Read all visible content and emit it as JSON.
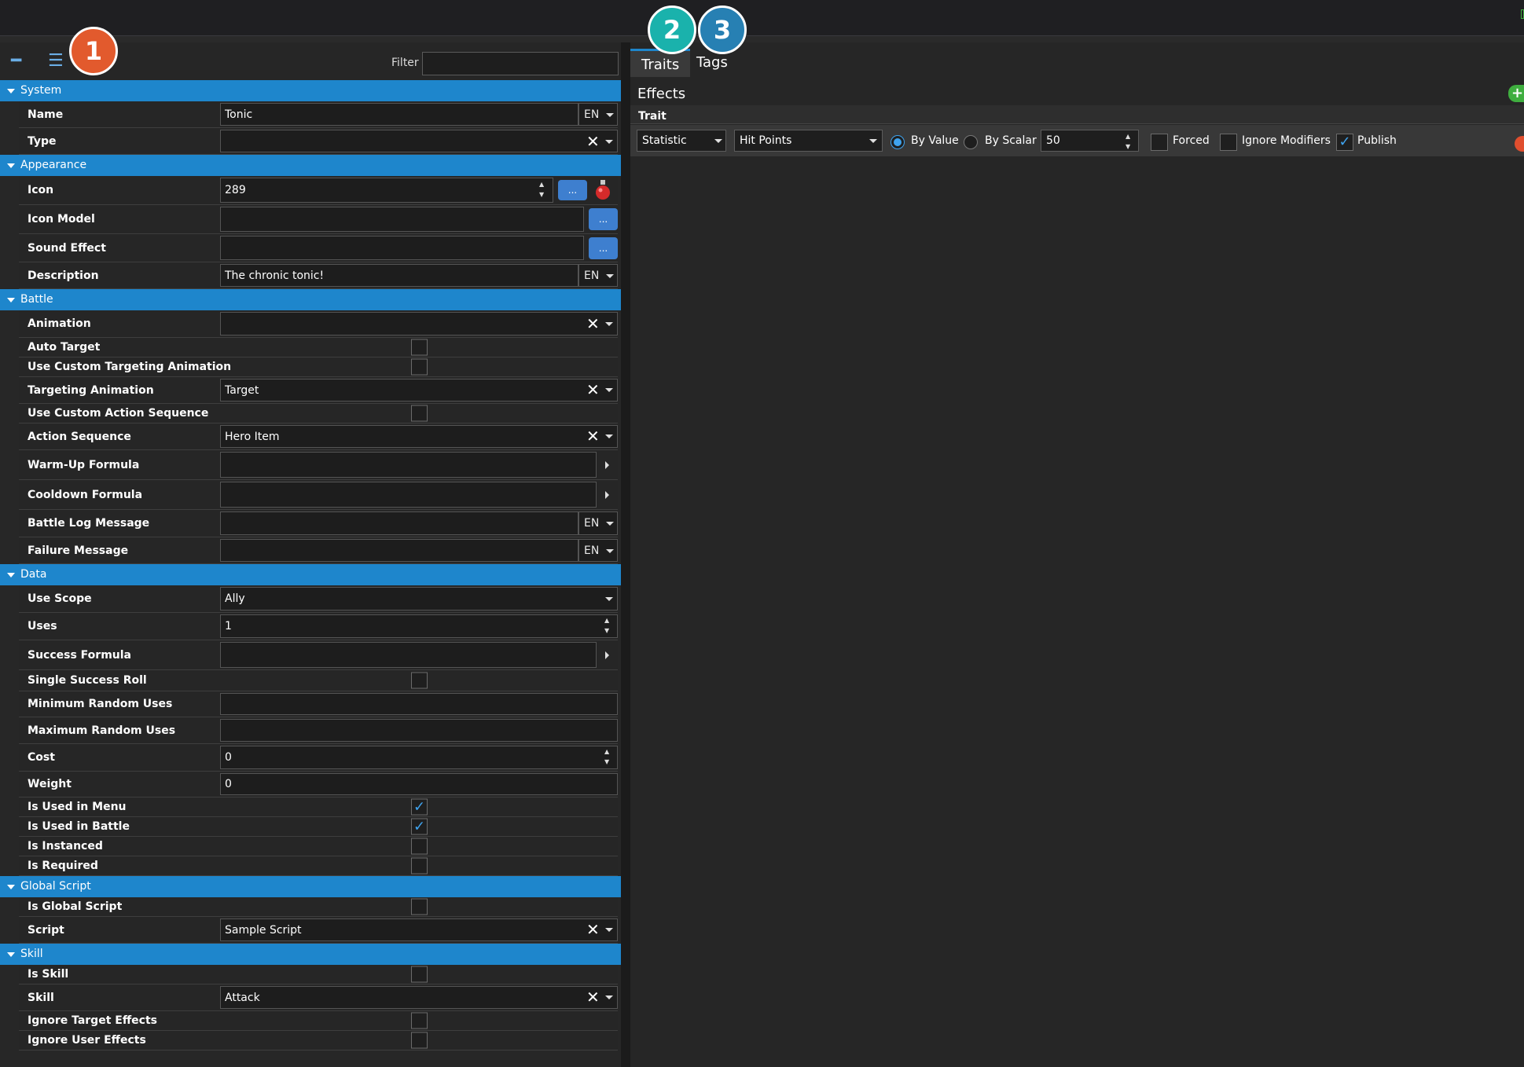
{
  "toolbar": {
    "filter_label": "Filter",
    "filter_value": ""
  },
  "badges": [
    "1",
    "2",
    "3"
  ],
  "groups": {
    "system": "System",
    "appearance": "Appearance",
    "battle": "Battle",
    "data": "Data",
    "global_script": "Global Script",
    "skill": "Skill"
  },
  "fields": {
    "name": {
      "label": "Name",
      "value": "Tonic",
      "lang": "EN"
    },
    "type": {
      "label": "Type",
      "value": ""
    },
    "icon": {
      "label": "Icon",
      "value": "289",
      "browse": "..."
    },
    "icon_model": {
      "label": "Icon Model",
      "value": "",
      "browse": "..."
    },
    "sound_effect": {
      "label": "Sound Effect",
      "value": "",
      "browse": "..."
    },
    "description": {
      "label": "Description",
      "value": "The chronic tonic!",
      "lang": "EN"
    },
    "animation": {
      "label": "Animation",
      "value": ""
    },
    "auto_target": {
      "label": "Auto Target",
      "checked": false
    },
    "use_custom_targeting_animation": {
      "label": "Use Custom Targeting Animation",
      "checked": false
    },
    "targeting_animation": {
      "label": "Targeting Animation",
      "value": "Target"
    },
    "use_custom_action_sequence": {
      "label": "Use Custom Action Sequence",
      "checked": false
    },
    "action_sequence": {
      "label": "Action Sequence",
      "value": "Hero Item"
    },
    "warm_up_formula": {
      "label": "Warm-Up Formula",
      "value": ""
    },
    "cooldown_formula": {
      "label": "Cooldown Formula",
      "value": ""
    },
    "battle_log_message": {
      "label": "Battle Log Message",
      "value": "",
      "lang": "EN"
    },
    "failure_message": {
      "label": "Failure Message",
      "value": "",
      "lang": "EN"
    },
    "use_scope": {
      "label": "Use Scope",
      "value": "Ally"
    },
    "uses": {
      "label": "Uses",
      "value": "1"
    },
    "success_formula": {
      "label": "Success Formula",
      "value": ""
    },
    "single_success_roll": {
      "label": "Single Success Roll",
      "checked": false
    },
    "minimum_random_uses": {
      "label": "Minimum Random Uses",
      "value": ""
    },
    "maximum_random_uses": {
      "label": "Maximum Random Uses",
      "value": ""
    },
    "cost": {
      "label": "Cost",
      "value": "0"
    },
    "weight": {
      "label": "Weight",
      "value": "0"
    },
    "is_used_in_menu": {
      "label": "Is Used in Menu",
      "checked": true
    },
    "is_used_in_battle": {
      "label": "Is Used in Battle",
      "checked": true
    },
    "is_instanced": {
      "label": "Is Instanced",
      "checked": false
    },
    "is_required": {
      "label": "Is Required",
      "checked": false
    },
    "is_global_script": {
      "label": "Is Global Script",
      "checked": false
    },
    "script": {
      "label": "Script",
      "value": "Sample Script"
    },
    "is_skill": {
      "label": "Is Skill",
      "checked": false
    },
    "skill": {
      "label": "Skill",
      "value": "Attack"
    },
    "ignore_target_effects": {
      "label": "Ignore Target Effects",
      "checked": false
    },
    "ignore_user_effects": {
      "label": "Ignore User Effects",
      "checked": false
    }
  },
  "right": {
    "tabs": [
      "Traits",
      "Tags"
    ],
    "effects_title": "Effects",
    "trait_header": "Trait",
    "trait": {
      "kind": "Statistic",
      "stat": "Hit Points",
      "by_value": "By Value",
      "by_scalar": "By Scalar",
      "mode_selected": "By Value",
      "amount": "50",
      "forced": "Forced",
      "forced_checked": false,
      "ignore_modifiers": "Ignore Modifiers",
      "ignore_modifiers_checked": false,
      "publish": "Publish",
      "publish_checked": true
    }
  },
  "check_glyph": "✓",
  "clear_glyph": "✕",
  "colors": {
    "accent": "#1e86cc",
    "badge1": "#e25a2d",
    "badge2": "#1ab2ac",
    "badge3": "#2780b3",
    "check": "#3fa3ee"
  }
}
